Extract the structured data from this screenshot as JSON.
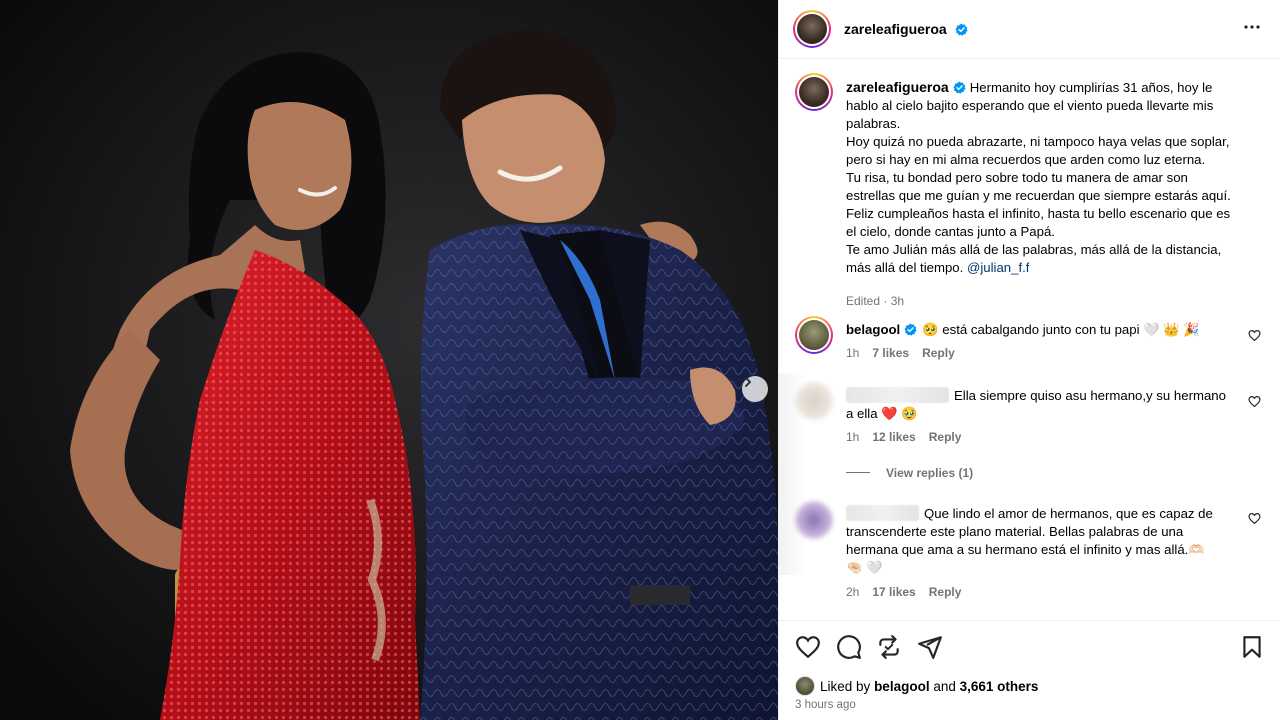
{
  "post": {
    "author": "zareleafigueroa",
    "caption_author": "zareleafigueroa",
    "caption_lines": [
      "Hermanito hoy cumplirías 31 años, hoy le",
      "hablo al cielo bajito esperando que el viento pueda llevarte mis",
      "palabras.",
      "Hoy quizá no pueda abrazarte, ni tampoco haya velas que soplar,",
      "pero si hay en mi alma recuerdos que arden como luz eterna.",
      "Tu risa, tu bondad pero sobre todo tu manera de amar son",
      "estrellas que me guían y me recuerdan que siempre estarás aquí.",
      "Feliz cumpleaños hasta el infinito, hasta tu bello escenario que es",
      "el cielo, donde cantas junto a Papá.",
      "Te amo Julián más allá de las palabras, más allá de la distancia,",
      "más allá del tiempo. "
    ],
    "mention": "@julian_f.f",
    "caption_meta": "Edited · 3h",
    "liked_prefix": "Liked by ",
    "liked_user": "belagool",
    "liked_and": " and ",
    "liked_others": "3,661 others",
    "timestamp": "3 hours ago"
  },
  "comments": [
    {
      "user": "belagool",
      "text": "🥺 está cabalgando junto con tu papi 🤍 👑 🎉",
      "time": "1h",
      "likes": "7 likes",
      "reply": "Reply"
    },
    {
      "user": "",
      "text_line1": "Ella siempre quiso asu hermano,y su hermano",
      "text_line2": "a ella ❤️ 🥹",
      "time": "1h",
      "likes": "12 likes",
      "reply": "Reply",
      "view_replies": "View replies (1)"
    },
    {
      "user": "",
      "text_line1": "Que lindo el amor de hermanos, que es capaz de",
      "text_line2": "transcenderte este plano material. Bellas palabras de una",
      "text_line3": "hermana que ama a su hermano está el infinito y mas allá.🫶🏻",
      "text_line4": "🤏🏻 🤍",
      "time": "2h",
      "likes": "17 likes",
      "reply": "Reply"
    }
  ],
  "icons": {
    "verified": "verified-badge-icon",
    "more": "more-options-icon",
    "next": "chevron-right-icon",
    "like": "heart-icon",
    "comment": "comment-icon",
    "share": "repost-icon",
    "send": "send-icon",
    "save": "bookmark-icon"
  },
  "colors": {
    "verified": "#0095f6",
    "muted": "#737373",
    "mention": "#00376b",
    "border": "#efefef"
  }
}
